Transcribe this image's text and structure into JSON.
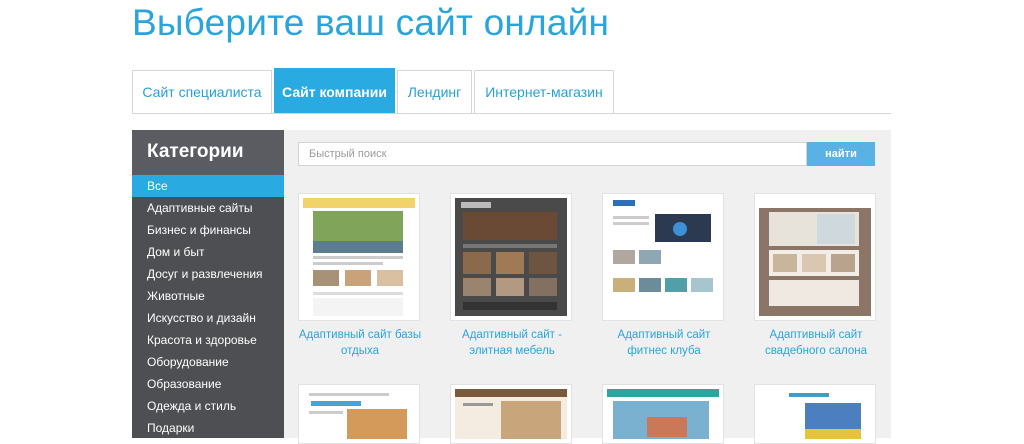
{
  "page": {
    "title": "Выберите ваш сайт онлайн"
  },
  "tabs": [
    {
      "label": "Сайт специалиста",
      "active": false
    },
    {
      "label": "Сайт компании",
      "active": true
    },
    {
      "label": "Лендинг",
      "active": false
    },
    {
      "label": "Интернет-магазин",
      "active": false
    }
  ],
  "sidebar": {
    "heading": "Категории",
    "items": [
      {
        "label": "Все",
        "active": true
      },
      {
        "label": "Адаптивные сайты"
      },
      {
        "label": "Бизнес и финансы"
      },
      {
        "label": "Дом и быт"
      },
      {
        "label": "Досуг и развлечения"
      },
      {
        "label": "Животные"
      },
      {
        "label": "Искусство и дизайн"
      },
      {
        "label": "Красота и здоровье"
      },
      {
        "label": "Оборудование"
      },
      {
        "label": "Образование"
      },
      {
        "label": "Одежда и стиль"
      },
      {
        "label": "Подарки"
      }
    ]
  },
  "search": {
    "placeholder": "Быстрый поиск",
    "button_label": "найти"
  },
  "templates": [
    {
      "line1": "Адаптивный сайт базы",
      "line2": "отдыха"
    },
    {
      "line1": "Адаптивный сайт -",
      "line2": "элитная мебель"
    },
    {
      "line1": "Адаптивный сайт",
      "line2": "фитнес клуба"
    },
    {
      "line1": "Адаптивный сайт",
      "line2": "свадебного салона"
    }
  ],
  "colors": {
    "accent": "#29abe2",
    "sidebar": "#4d4f53",
    "link": "#29a4dd"
  }
}
